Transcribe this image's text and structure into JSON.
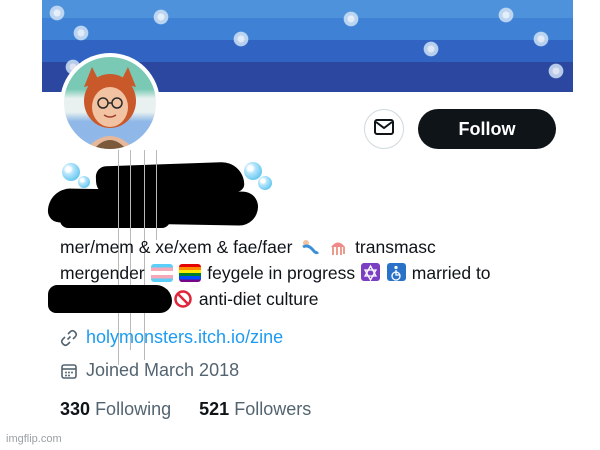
{
  "profile": {
    "follow_label": "Follow",
    "bio_lines": [
      "mer/mem & xe/xem & fae/faer",
      "transmasc",
      "mergender",
      "feygele in progress",
      "married to",
      "anti-diet culture"
    ],
    "link_text": "holymonsters.itch.io/zine",
    "joined_text": "Joined March 2018",
    "following_count": "330",
    "following_label": "Following",
    "followers_count": "521",
    "followers_label": "Followers"
  },
  "icons": {
    "message": "envelope-icon",
    "link": "link-icon",
    "calendar": "calendar-icon",
    "mermaid": "merperson-emoji",
    "jellyfish": "jellyfish-emoji",
    "trans_flag": "transgender-flag-emoji",
    "rainbow_flag": "rainbow-flag-emoji",
    "star_of_david": "star-of-david-emoji",
    "wheelchair": "wheelchair-emoji",
    "prohibited": "prohibited-emoji"
  },
  "watermark": "imgflip.com",
  "colors": {
    "follow_bg": "#0f1419",
    "link": "#1d9bf0",
    "muted": "#536471"
  }
}
